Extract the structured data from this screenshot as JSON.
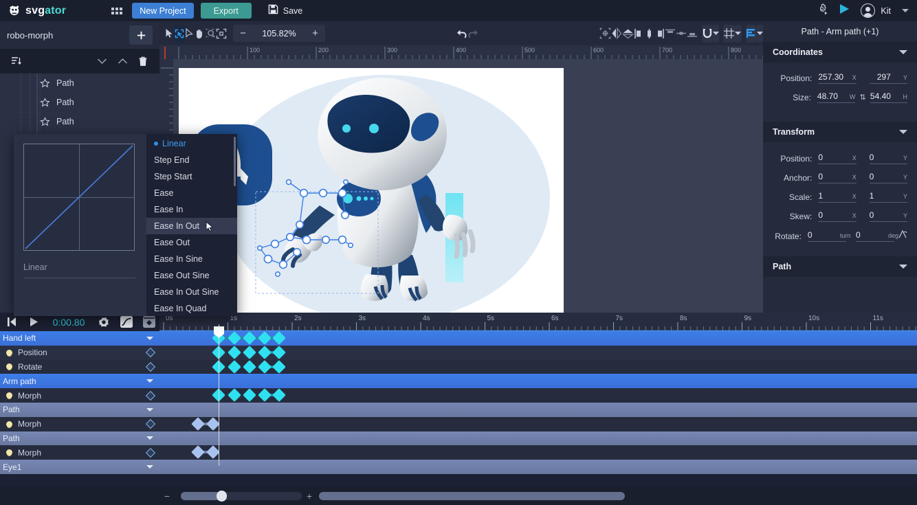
{
  "topbar": {
    "logo_text_1": "svg",
    "logo_text_2": "ator",
    "grid_icon": "grid-apps-icon",
    "new_project_label": "New Project",
    "export_label": "Export",
    "save_label": "Save",
    "save_icon": "floppy-disk-icon",
    "settings_icon": "animated-gear-icon",
    "preview_icon": "play-icon",
    "user_icon": "user-avatar-icon",
    "user_name": "Kit",
    "dropdown_icon": "chevron-down-icon"
  },
  "left_panel": {
    "project_name": "robo-morph",
    "add_label": "+",
    "add_icon": "plus-icon",
    "tools": [
      {
        "name": "sort-layers-icon"
      },
      {
        "name": "move-down-icon"
      },
      {
        "name": "move-up-icon"
      },
      {
        "name": "delete-icon"
      }
    ],
    "layers": [
      {
        "label": "Path",
        "icon": "star-path-icon"
      },
      {
        "label": "Path",
        "icon": "star-path-icon"
      },
      {
        "label": "Path",
        "icon": "star-path-icon"
      }
    ]
  },
  "easing_popup": {
    "curve_label": "Linear",
    "selected": "Linear",
    "highlighted": "Ease In Out",
    "cursor_icon": "mouse-pointer-icon",
    "options": [
      "Linear",
      "Step End",
      "Step Start",
      "Ease",
      "Ease In",
      "Ease In Out",
      "Ease Out",
      "Ease In Sine",
      "Ease Out Sine",
      "Ease In Out Sine",
      "Ease In Quad"
    ]
  },
  "canvas_toolbar": {
    "tools": [
      {
        "name": "select-arrow-icon",
        "active": false
      },
      {
        "name": "node-edit-icon",
        "active": true
      },
      {
        "name": "direct-select-icon",
        "active": false
      },
      {
        "name": "hand-pan-icon",
        "active": false
      },
      {
        "name": "zoom-region-icon",
        "active": false
      },
      {
        "name": "fit-to-screen-icon",
        "active": false
      }
    ],
    "zoom_minus": "−",
    "zoom_value": "105.82%",
    "zoom_plus": "+",
    "undo_icon": "undo-arrow-icon",
    "redo_icon": "redo-arrow-icon",
    "right_tools": [
      {
        "name": "transform-origin-icon"
      },
      {
        "name": "flip-horizontal-icon"
      },
      {
        "name": "flip-vertical-icon"
      },
      {
        "name": "align-left-icon"
      },
      {
        "name": "align-center-horizontal-icon"
      },
      {
        "name": "align-right-icon"
      },
      {
        "name": "align-top-icon"
      },
      {
        "name": "align-middle-vertical-icon"
      },
      {
        "name": "align-bottom-icon"
      }
    ],
    "snap_icon": "magnet-snap-icon",
    "grid_icon": "grid-icon",
    "ruler_icon": "ruler-icon"
  },
  "horizontal_ruler": {
    "labels": [
      "100",
      "200",
      "300",
      "400",
      "500",
      "600",
      "700",
      "800"
    ],
    "spacing": 100
  },
  "right_panel": {
    "title": "Path - Arm path (+1)",
    "sections": [
      {
        "title": "Coordinates",
        "rows": [
          {
            "label": "Position:",
            "x_value": "257.30",
            "x_unit": "X",
            "y_value": "297",
            "y_unit": "Y",
            "link": false
          },
          {
            "label": "Size:",
            "x_value": "48.70",
            "x_unit": "W",
            "y_value": "54.40",
            "y_unit": "H",
            "link": true,
            "link_icon": "link-ratio-icon"
          }
        ]
      },
      {
        "title": "Transform",
        "rows": [
          {
            "label": "Position:",
            "x_value": "0",
            "x_unit": "X",
            "y_value": "0",
            "y_unit": "Y",
            "link": false
          },
          {
            "label": "Anchor:",
            "x_value": "0",
            "x_unit": "X",
            "y_value": "0",
            "y_unit": "Y",
            "link": false
          },
          {
            "label": "Scale:",
            "x_value": "1",
            "x_unit": "X",
            "y_value": "1",
            "y_unit": "Y",
            "link": false
          },
          {
            "label": "Skew:",
            "x_value": "0",
            "x_unit": "X",
            "y_value": "0",
            "y_unit": "Y",
            "link": false
          },
          {
            "label": "Rotate:",
            "x_value": "0",
            "x_unit": "turn",
            "y_value": "0",
            "y_unit": "deg",
            "link": false,
            "extra_icon": "rotate-handle-icon"
          }
        ]
      },
      {
        "title": "Path",
        "rows": []
      }
    ]
  },
  "timeline": {
    "controls": {
      "rewind_icon": "skip-to-start-icon",
      "play_icon": "play-icon",
      "current_time": "0:00.80",
      "settings_icon": "gear-icon",
      "easing_icon": "easing-curve-icon",
      "keyframe_nav_icon": "keyframe-panel-icon"
    },
    "ruler_labels": [
      "0s",
      "1s",
      "2s",
      "3s",
      "4s",
      "5s",
      "6s",
      "7s",
      "8s",
      "9s",
      "10s",
      "11s"
    ],
    "playhead_time": "0.80",
    "rows": [
      {
        "type": "group",
        "label": "Hand left",
        "selected": true,
        "keyframes": [
          318,
          341,
          363,
          385,
          406
        ],
        "kf_style": "sel",
        "links": [
          [
            318,
            406
          ]
        ]
      },
      {
        "type": "prop",
        "label": "Position",
        "icon": "bulb-icon",
        "kf_icon": "keyframe-diamond-icon",
        "keyframes": [
          318,
          341,
          363,
          385,
          406
        ],
        "kf_style": "sel",
        "links": [
          [
            385,
            406
          ]
        ]
      },
      {
        "type": "prop",
        "label": "Rotate",
        "icon": "bulb-icon",
        "kf_icon": "keyframe-diamond-icon",
        "keyframes": [
          318,
          341,
          363,
          385,
          406
        ],
        "kf_style": "sel",
        "links": [
          [
            385,
            406
          ]
        ]
      },
      {
        "type": "group",
        "label": "Arm path",
        "selected": true,
        "keyframes": [],
        "kf_style": "sel",
        "links": []
      },
      {
        "type": "prop",
        "label": "Morph",
        "icon": "bulb-icon",
        "kf_icon": "keyframe-diamond-icon",
        "keyframes": [
          318,
          341,
          363,
          385,
          406
        ],
        "kf_style": "sel",
        "links": [
          [
            385,
            406
          ]
        ]
      },
      {
        "type": "group",
        "label": "Path",
        "selected": false,
        "keyframes": [],
        "kf_style": "unsel",
        "links": []
      },
      {
        "type": "prop",
        "label": "Morph",
        "icon": "bulb-icon",
        "kf_icon": "keyframe-diamond-icon",
        "keyframes": [
          288,
          310
        ],
        "kf_style": "unsel",
        "links": [
          [
            288,
            310
          ]
        ]
      },
      {
        "type": "group",
        "label": "Path",
        "selected": false,
        "keyframes": [],
        "kf_style": "unsel",
        "links": []
      },
      {
        "type": "prop",
        "label": "Morph",
        "icon": "bulb-icon",
        "kf_icon": "keyframe-diamond-icon",
        "keyframes": [
          288,
          310
        ],
        "kf_style": "unsel",
        "links": [
          [
            288,
            310
          ]
        ]
      },
      {
        "type": "group",
        "label": "Eye1",
        "selected": false,
        "keyframes": [],
        "kf_style": "unsel",
        "links": []
      }
    ],
    "bottom": {
      "zoom_out_label": "−",
      "zoom_in_label": "+",
      "zoom_slider_icon": "timeline-zoom-slider",
      "hscroll_icon": "horizontal-scrollbar"
    }
  }
}
